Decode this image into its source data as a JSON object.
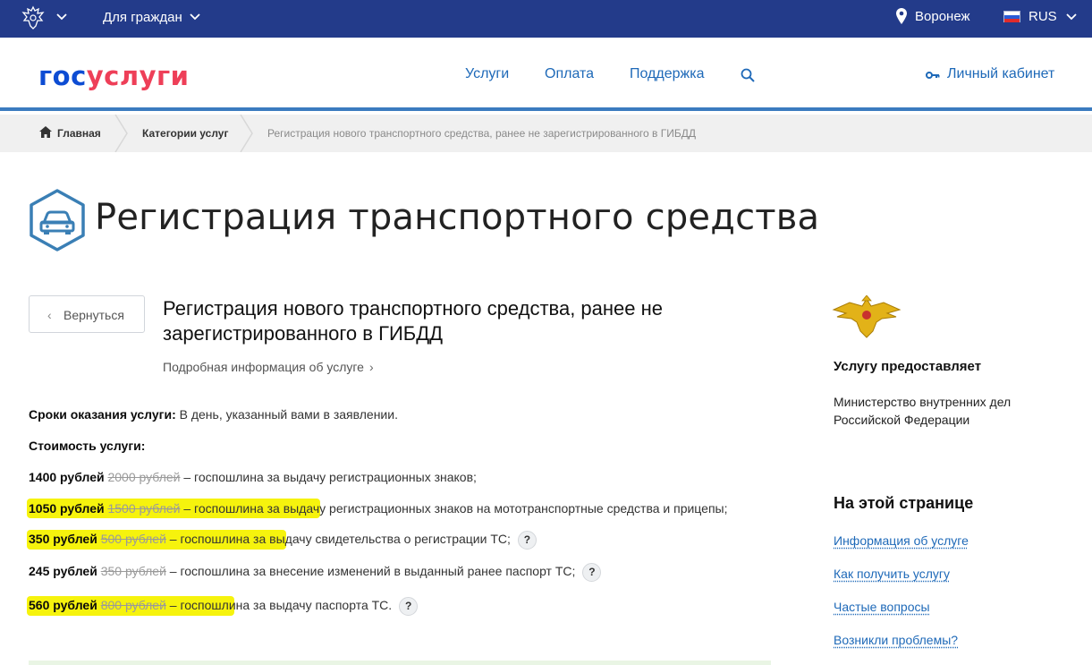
{
  "topbar": {
    "for_citizens": "Для граждан",
    "city": "Воронеж",
    "lang": "RUS"
  },
  "header": {
    "logo_gos": "гос",
    "logo_uslugi": "услуги",
    "nav": [
      "Услуги",
      "Оплата",
      "Поддержка"
    ],
    "cabinet": "Личный кабинет"
  },
  "breadcrumb": {
    "home": "Главная",
    "categories": "Категории услуг",
    "current": "Регистрация нового транспортного средства, ранее не зарегистрированного в ГИБДД"
  },
  "page": {
    "title": "Регистрация транспортного средства",
    "back": "Вернуться",
    "service_title": "Регистрация нового транспортного средства, ранее не зарегистрированного в ГИБДД",
    "detail_link": "Подробная информация об услуге",
    "terms_label": "Сроки оказания услуги:",
    "terms_value": " В день, указанный вами в заявлении.",
    "cost_label": "Стоимость услуги:",
    "fees": [
      {
        "new": "1400 рублей",
        "old": "2000 рублей",
        "desc": " – госпошлина за выдачу регистрационных знаков;",
        "help": false,
        "highlight": 0
      },
      {
        "new": "1050 рублей",
        "old": "1500 рублей",
        "desc": " – госпошлина за выдачу регистрационных знаков на мототранспортные средства и прицепы;",
        "help": false,
        "highlight": 1
      },
      {
        "new": "350 рублей",
        "old": "500 рублей",
        "desc": " – госпошлина за выдачу свидетельства о регистрации ТС;",
        "help": true,
        "highlight": 1
      },
      {
        "new": "245 рублей",
        "old": "350 рублей",
        "desc": " – госпошлина за внесение изменений в выданный ранее паспорт ТС;",
        "help": true,
        "highlight": 0
      },
      {
        "new": "560 рублей",
        "old": "800 рублей",
        "desc": " – госпошлина за выдачу паспорта ТС.",
        "help": true,
        "highlight": 1
      }
    ],
    "help_glyph": "?"
  },
  "sidebar": {
    "provider_heading": "Услугу предоставляет",
    "provider": "Министерство внутренних дел Российской Федерации",
    "onpage_heading": "На этой странице",
    "links": [
      "Информация об услуге",
      "Как получить услугу",
      "Частые вопросы",
      "Возникли проблемы?"
    ]
  },
  "colors": {
    "topbar": "#233b8a",
    "link": "#1e69b8",
    "highlight": "#f6f200",
    "logo_blue": "#0d4cd3",
    "logo_red": "#ee3f58"
  }
}
